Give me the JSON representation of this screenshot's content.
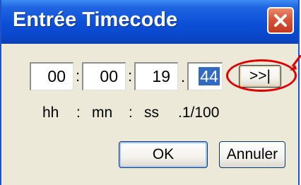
{
  "window": {
    "title": "Entrée Timecode",
    "close_icon": "close-icon",
    "accent": "#0b4fd8"
  },
  "timecode": {
    "hours": "00",
    "minutes": "00",
    "seconds": "19",
    "frames": "44",
    "separator_colon": ":",
    "separator_dot": "."
  },
  "labels": {
    "hh": "hh",
    "colon1": ":",
    "mn": "mn",
    "colon2": ":",
    "ss": "ss",
    "hundredths": ".1/100"
  },
  "buttons": {
    "skip_label": ">>|",
    "ok_label": "OK",
    "cancel_label": "Annuler"
  },
  "annotation": {
    "ring_color": "#e00000"
  }
}
